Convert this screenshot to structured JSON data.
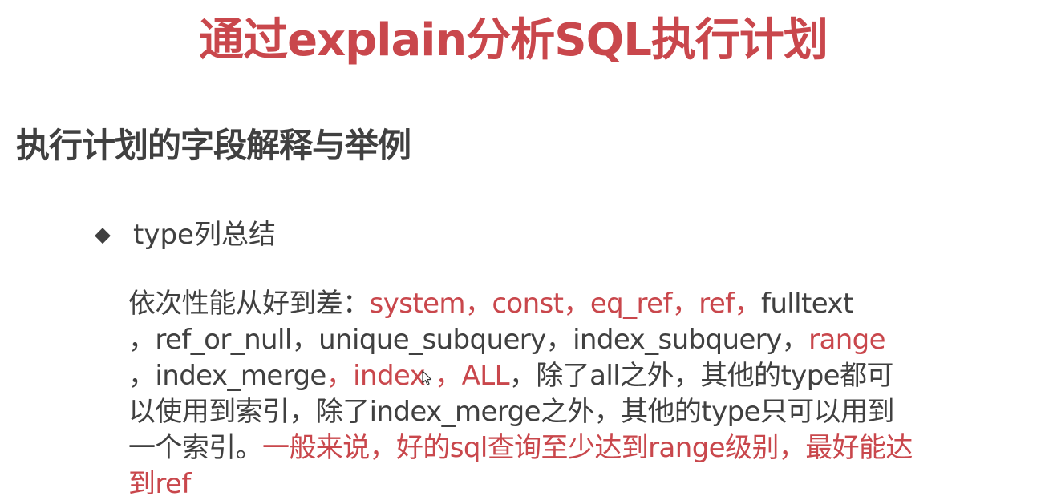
{
  "colors": {
    "accent": "#c9474c",
    "text": "#404040",
    "background": "#ffffff"
  },
  "slide": {
    "title": "通过explain分析SQL执行计划",
    "subtitle": "执行计划的字段解释与举例",
    "bullet": {
      "marker": "◆",
      "text": "type列总结"
    },
    "body_lines": [
      [
        {
          "text": "依次性能从好到差：",
          "style": "normal"
        },
        {
          "text": "system，const，eq_ref，ref，",
          "style": "accent"
        },
        {
          "text": "fulltext",
          "style": "normal"
        }
      ],
      [
        {
          "text": "，ref_or_null，unique_subquery，index_subquery，",
          "style": "normal"
        },
        {
          "text": "range",
          "style": "accent"
        }
      ],
      [
        {
          "text": "，index_merge",
          "style": "normal"
        },
        {
          "text": "，index",
          "style": "accent"
        },
        {
          "icon": "mouse-cursor-icon"
        },
        {
          "text": "，ALL",
          "style": "accent"
        },
        {
          "text": "，除了all之外，其他的type都可",
          "style": "normal"
        }
      ],
      [
        {
          "text": "以使用到索引，除了index_merge之外，其他的type只可以用到",
          "style": "normal"
        }
      ],
      [
        {
          "text": "一个索引。",
          "style": "normal"
        },
        {
          "text": "一般来说，好的sql查询至少达到range级别，最好能达",
          "style": "accent"
        }
      ],
      [
        {
          "text": "到ref",
          "style": "accent"
        }
      ]
    ]
  }
}
